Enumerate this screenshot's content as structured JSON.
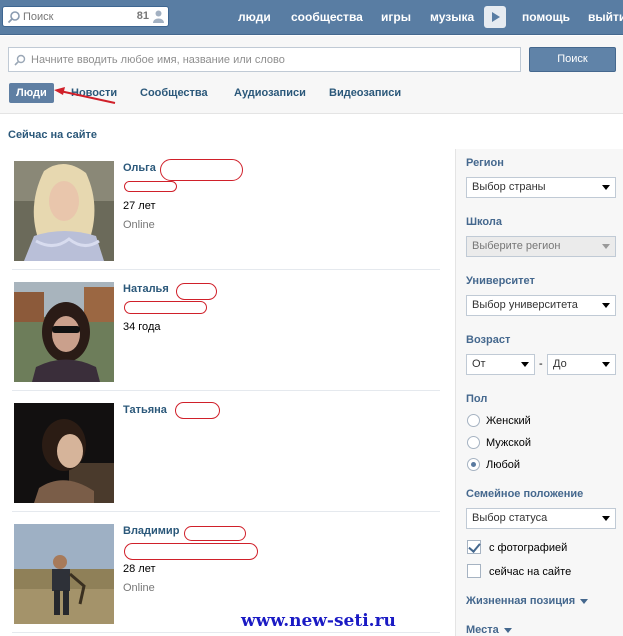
{
  "header": {
    "search_placeholder": "Поиск",
    "count": "81",
    "nav": [
      "люди",
      "сообщества",
      "игры",
      "музыка",
      "помощь",
      "выйти"
    ]
  },
  "search": {
    "placeholder": "Начните вводить любое имя, название или слово",
    "button": "Поиск",
    "tabs": [
      "Люди",
      "Новости",
      "Сообщества",
      "Аудиозаписи",
      "Видеозаписи"
    ],
    "active_tab": "Люди"
  },
  "section_title": "Сейчас на сайте",
  "people": [
    {
      "name": "Ольга",
      "age": "27 лет",
      "status": "Online"
    },
    {
      "name": "Наталья",
      "age": "34 года",
      "status": ""
    },
    {
      "name": "Татьяна",
      "age": "",
      "status": ""
    },
    {
      "name": "Владимир",
      "age": "28 лет",
      "status": "Online"
    }
  ],
  "filters": {
    "region": {
      "title": "Регион",
      "value": "Выбор страны"
    },
    "school": {
      "title": "Школа",
      "value": "Выберите регион"
    },
    "university": {
      "title": "Университет",
      "value": "Выбор университета"
    },
    "age": {
      "title": "Возраст",
      "from": "От",
      "to": "До",
      "dash": "-"
    },
    "gender": {
      "title": "Пол",
      "options": [
        "Женский",
        "Мужской",
        "Любой"
      ],
      "selected": "Любой"
    },
    "marital": {
      "title": "Семейное положение",
      "value": "Выбор статуса"
    },
    "with_photo": {
      "label": "с фотографией",
      "checked": true
    },
    "online_now": {
      "label": "сейчас на сайте",
      "checked": false
    },
    "life_position": "Жизненная позиция",
    "places": "Места"
  },
  "watermark": "www.new-seti.ru",
  "colors": {
    "header": "#597da3",
    "link": "#2b587a",
    "annotation": "#d0202a"
  }
}
